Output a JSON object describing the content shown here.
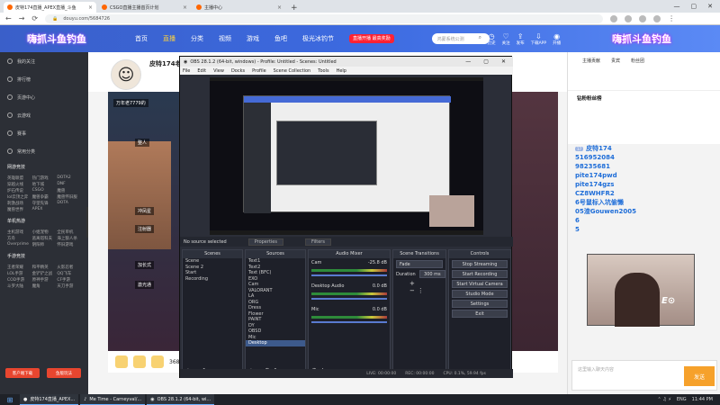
{
  "browser": {
    "tabs": [
      {
        "label": "皮特174直播_APEX直播_斗鱼"
      },
      {
        "label": "CSGO直播主播首页计划"
      },
      {
        "label": "主播中心"
      }
    ],
    "url": "douyu.com/5684726"
  },
  "site": {
    "logo": "嗨抓斗鱼钓鱼",
    "nav": [
      "首页",
      "直播",
      "分类",
      "视频",
      "游戏",
      "鱼吧",
      "极光冰钓节"
    ],
    "search_placeholder": "鸿蒙系统公测",
    "star_button": "直播开播\n最高奖励",
    "icons": [
      "历史",
      "关注",
      "发布",
      "下载APP",
      "开播"
    ],
    "banner": "嗨抓斗鱼钓鱼"
  },
  "sidebar": {
    "items": [
      "我的关注",
      "排行榜",
      "页游中心",
      "云游戏",
      "赛事",
      "常用分类"
    ],
    "groups": [
      {
        "title": "网游竞技",
        "cells": [
          "英雄联盟",
          "热门游戏",
          "DOTA2",
          "穿越火线",
          "地下城",
          "DNF",
          "炉石传说",
          "CSGO",
          "魔兽",
          "lol云顶之弈",
          "魔兽争霸",
          "魔兽怀旧服",
          "刺激战场",
          "守望先锋",
          "DOTA",
          "魔兽世界",
          "APEX"
        ]
      },
      {
        "title": "单机热游",
        "cells": [
          "主机游戏",
          "小姐宠物",
          "全民单机",
          "方舟",
          "逃离塔科夫",
          "海上狼人杀",
          "Overprime",
          "阴阳师",
          "怀旧游戏"
        ]
      },
      {
        "title": "手游竞技",
        "cells": [
          "王者荣耀",
          "和平精英",
          "火影忍者",
          "LOL手游",
          "金铲铲之战",
          "QQ飞车",
          "COD手游",
          "原神手游",
          "CF手游",
          "斗罗大陆",
          "魔角",
          "天刀手游"
        ]
      }
    ],
    "btn_live": "客户端下载",
    "btn_game": "鱼版玩法"
  },
  "stream": {
    "streamer": "皮特174老",
    "follow_count": "3684726",
    "labels": [
      "万年老7779的",
      "整人",
      "冲凤星",
      "注射器",
      "加长式",
      "激光通"
    ]
  },
  "obs": {
    "title": "OBS 28.1.2 (64-bit, windows) - Profile: Untitled - Scenes: Untitled",
    "menu": [
      "File",
      "Edit",
      "View",
      "Docks",
      "Profile",
      "Scene Collection",
      "Tools",
      "Help"
    ],
    "no_source": "No source selected",
    "tabs": [
      "Properties",
      "Filters"
    ],
    "docks": [
      "Scenes",
      "Sources",
      "Audio Mixer",
      "Scene Transitions",
      "Controls"
    ],
    "scenes": [
      "Scene",
      "Scene 2",
      "Start",
      "Recording"
    ],
    "sources": [
      "Text1",
      "Text2",
      "Text (BFC)",
      "EXO",
      "Cam",
      "VALORANT",
      "LA",
      "ORG",
      "Dress",
      "Flower",
      "PAINT",
      "DY",
      "OBSD",
      "Mic",
      "Desktop"
    ],
    "audio": [
      {
        "name": "Cam",
        "db": "-25.8 dB"
      },
      {
        "name": "Desktop Audio",
        "db": "0.0 dB"
      },
      {
        "name": "Mic",
        "db": "0.0 dB"
      }
    ],
    "transition": {
      "type": "Fade",
      "duration_label": "Duration",
      "duration": "300 ms"
    },
    "controls": [
      "Stop Streaming",
      "Start Recording",
      "Start Virtual Camera",
      "Studio Mode",
      "Settings",
      "Exit"
    ],
    "status": [
      "LIVE: 00:00:00",
      "REC: 00:00:00",
      "CPU: 0.1%, 59.94 fps"
    ]
  },
  "right": {
    "tabs": [
      "主播贡献",
      "贵宾",
      "粉丝团"
    ],
    "rank_title": "钻粉粉丝榜",
    "chat": [
      {
        "lvl": "17",
        "name": "",
        "text": "皮特174"
      },
      {
        "lvl": "",
        "name": "",
        "text": "516952084"
      },
      {
        "lvl": "",
        "name": "",
        "text": "98235681"
      },
      {
        "lvl": "",
        "name": "",
        "text": "pite174pwd"
      },
      {
        "lvl": "",
        "name": "",
        "text": "pite174gzs"
      },
      {
        "lvl": "",
        "name": "",
        "text": "CZ8WHFR2"
      },
      {
        "lvl": "",
        "name": "",
        "text": "6号鼠标入坑偷懒"
      },
      {
        "lvl": "",
        "name": "",
        "text": "05渣Gouwen2005"
      },
      {
        "lvl": "",
        "name": "",
        "text": "6"
      },
      {
        "lvl": "",
        "name": "",
        "text": "5"
      }
    ],
    "chat_placeholder": "这里输入聊天内容",
    "send": "发送"
  },
  "webcam": {
    "tag": "E⊙"
  },
  "taskbar": {
    "apps": [
      "皮特174直播_APEX...",
      "Me Time - Carneyval/...",
      "OBS 28.1.2 (64-bit, wi..."
    ],
    "lang": "ENG",
    "time": "11:44 PM"
  }
}
